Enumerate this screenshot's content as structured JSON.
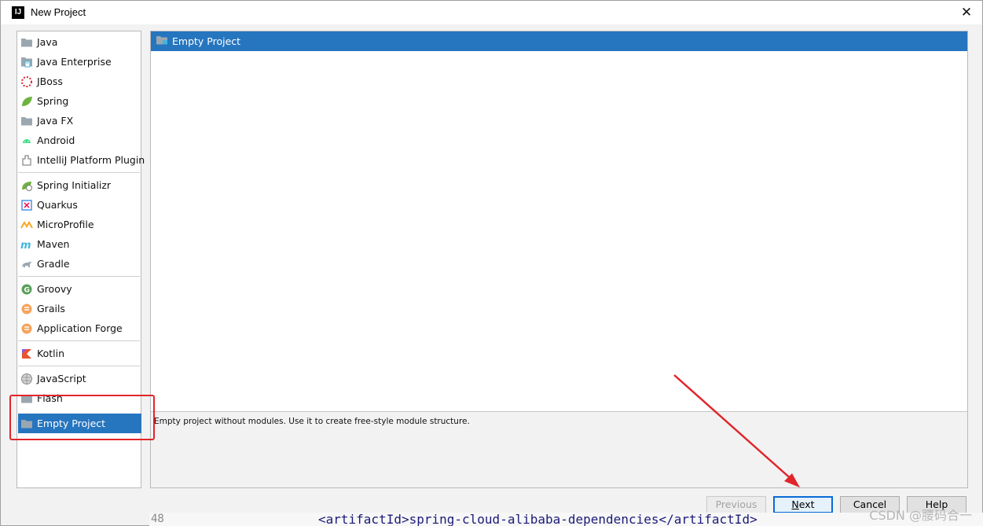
{
  "window": {
    "title": "New Project",
    "app_icon": "IJ",
    "close_label": "✕"
  },
  "left_list": {
    "groups": [
      [
        {
          "label": "Java",
          "icon": "folder-icon"
        },
        {
          "label": "Java Enterprise",
          "icon": "java-enterprise-icon"
        },
        {
          "label": "JBoss",
          "icon": "jboss-icon"
        },
        {
          "label": "Spring",
          "icon": "spring-leaf-icon"
        },
        {
          "label": "Java FX",
          "icon": "folder-icon"
        },
        {
          "label": "Android",
          "icon": "android-icon"
        },
        {
          "label": "IntelliJ Platform Plugin",
          "icon": "plugin-icon"
        }
      ],
      [
        {
          "label": "Spring Initializr",
          "icon": "spring-initializr-icon"
        },
        {
          "label": "Quarkus",
          "icon": "quarkus-icon"
        },
        {
          "label": "MicroProfile",
          "icon": "microprofile-icon"
        },
        {
          "label": "Maven",
          "icon": "maven-icon"
        },
        {
          "label": "Gradle",
          "icon": "gradle-icon"
        }
      ],
      [
        {
          "label": "Groovy",
          "icon": "groovy-icon"
        },
        {
          "label": "Grails",
          "icon": "grails-icon"
        },
        {
          "label": "Application Forge",
          "icon": "application-forge-icon"
        }
      ],
      [
        {
          "label": "Kotlin",
          "icon": "kotlin-icon"
        }
      ],
      [
        {
          "label": "JavaScript",
          "icon": "globe-icon"
        },
        {
          "label": "Flash",
          "icon": "folder-icon"
        },
        {
          "label": "Empty Project",
          "icon": "folder-icon",
          "selected": true
        }
      ]
    ]
  },
  "right_panel": {
    "selected_label": "Empty Project",
    "description": "Empty project without modules. Use it to create free-style module structure."
  },
  "buttons": {
    "previous": "Previous",
    "next_mnemonic": "N",
    "next_rest": "ext",
    "cancel": "Cancel",
    "help": "Help"
  },
  "background": {
    "line_number": "48",
    "code": "<artifactId>spring-cloud-alibaba-dependencies</artifactId>",
    "watermark": "CSDN @腰码合一"
  },
  "colors": {
    "selection": "#2675bf",
    "annotation": "#e0262b"
  }
}
